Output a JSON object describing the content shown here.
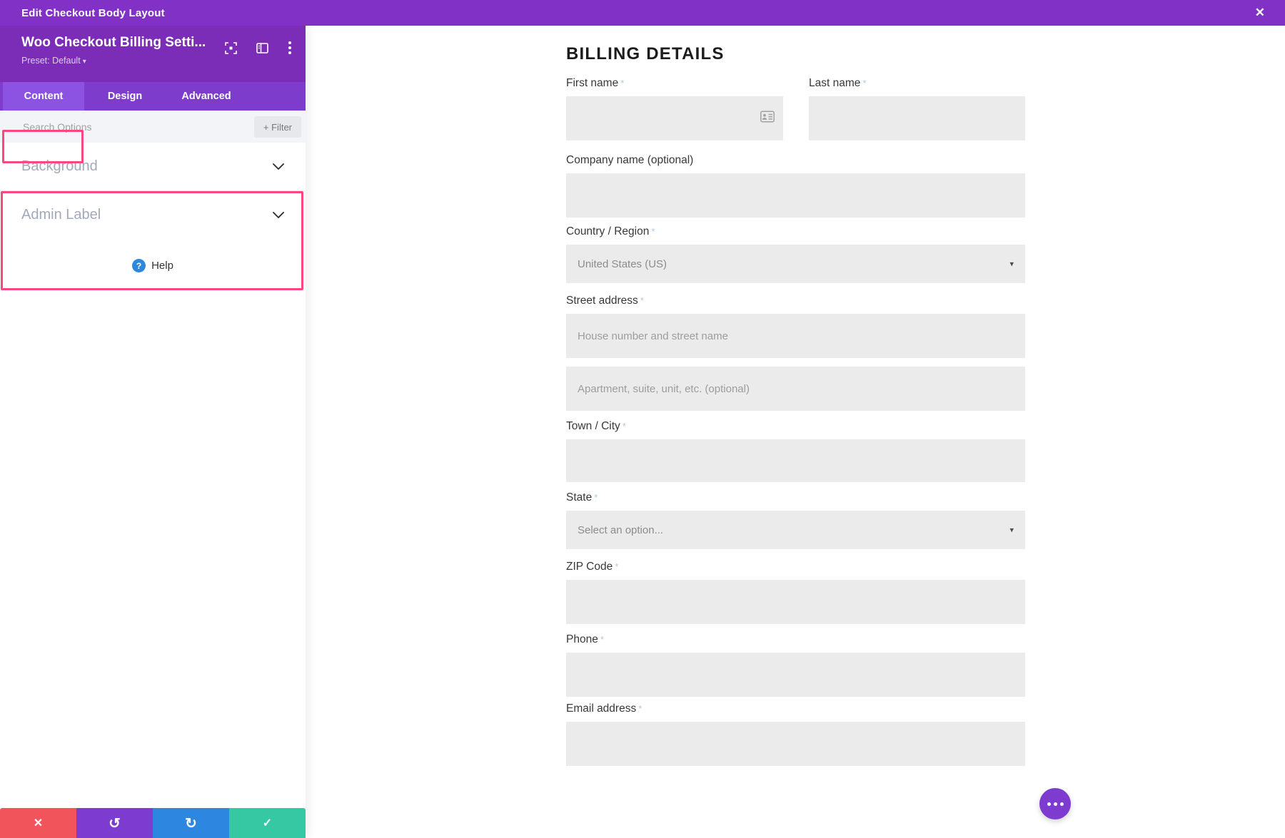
{
  "header": {
    "title": "Edit Checkout Body Layout"
  },
  "panel": {
    "module_title": "Woo Checkout Billing Setti...",
    "preset_label": "Preset: Default",
    "tabs": {
      "content": "Content",
      "design": "Design",
      "advanced": "Advanced"
    },
    "search_placeholder": "Search Options",
    "filter_button": "+ Filter",
    "sections": {
      "background": "Background",
      "admin_label": "Admin Label"
    },
    "help_label": "Help"
  },
  "form": {
    "title": "BILLING DETAILS",
    "required_mark": "*",
    "first_name": {
      "label": "First name",
      "value": ""
    },
    "last_name": {
      "label": "Last name",
      "value": ""
    },
    "company": {
      "label": "Company name (optional)",
      "value": ""
    },
    "country": {
      "label": "Country / Region",
      "value": "United States (US)"
    },
    "street": {
      "label": "Street address",
      "placeholder1": "House number and street name",
      "placeholder2": "Apartment, suite, unit, etc. (optional)"
    },
    "city": {
      "label": "Town / City",
      "value": ""
    },
    "state": {
      "label": "State",
      "value": "Select an option..."
    },
    "zip": {
      "label": "ZIP Code",
      "value": ""
    },
    "phone": {
      "label": "Phone",
      "value": ""
    },
    "email": {
      "label": "Email address",
      "value": ""
    }
  },
  "icons": {
    "close": "✕",
    "preset_caret": "▾",
    "select_caret": "▾",
    "help_question": "?",
    "discard": "✕",
    "undo": "↺",
    "redo": "↻",
    "save": "✓"
  },
  "colors": {
    "topbar_purple": "#8231c6",
    "panel_header_purple": "#7b2db8",
    "tabbar_purple": "#7e3ccd",
    "active_tab_purple": "#8c53e2",
    "annotation_pink": "#f8487f",
    "accent_purple": "#7e3bd0",
    "discard_red": "#f2545c",
    "redo_blue": "#2d87e0",
    "save_green": "#35c8a2",
    "help_blue": "#2d87dd",
    "field_gray": "#ebebeb"
  }
}
